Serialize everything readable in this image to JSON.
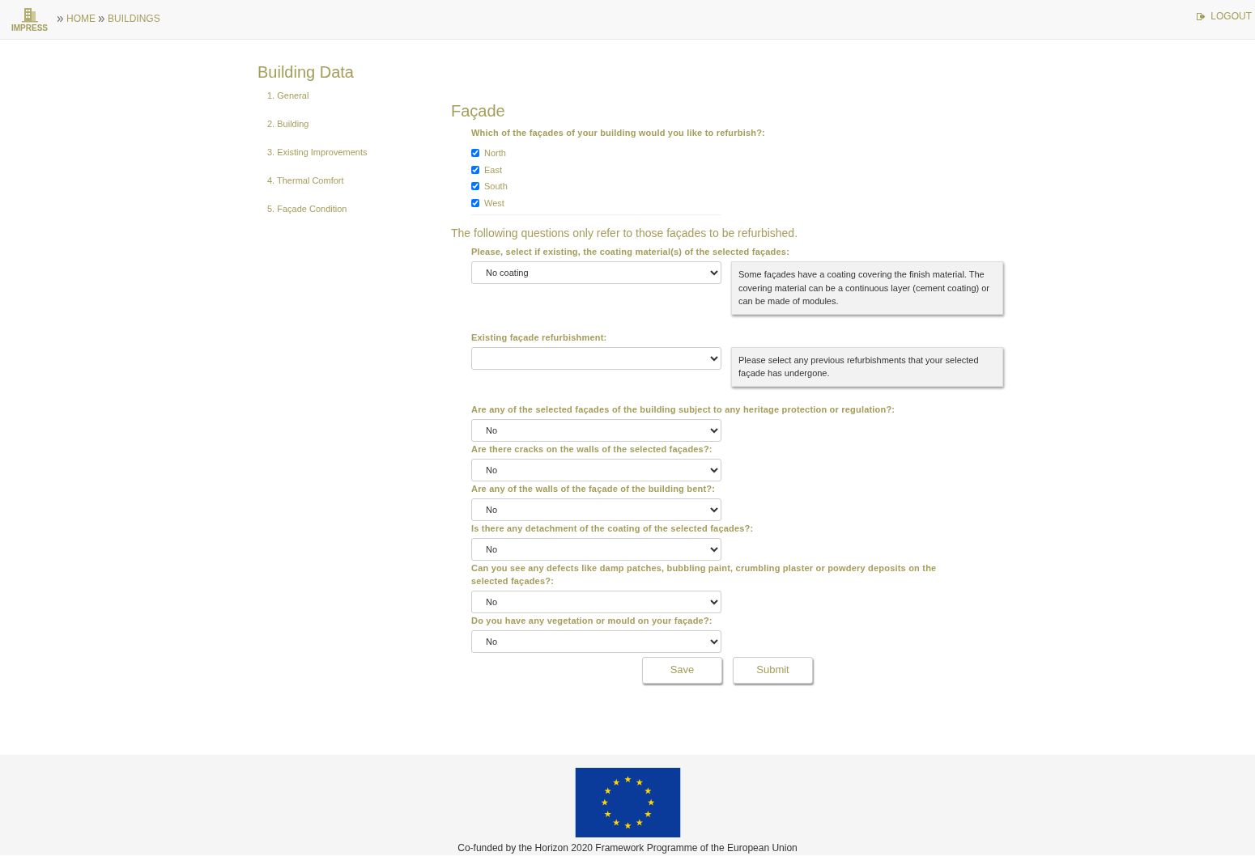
{
  "navbar": {
    "logo_text": "IMPRESS",
    "breadcrumb": [
      {
        "label": "HOME"
      },
      {
        "label": "BUILDINGS"
      }
    ],
    "logout": "LOGOUT"
  },
  "sidebar": {
    "title": "Building Data",
    "items": [
      {
        "label": "1. General"
      },
      {
        "label": "2. Building"
      },
      {
        "label": "3. Existing Improvements"
      },
      {
        "label": "4. Thermal Comfort"
      },
      {
        "label": "5. Façade Condition"
      }
    ]
  },
  "section": {
    "title": "Façade",
    "question": "Which of the façades of your building would you like to refurbish?:",
    "options": [
      {
        "label": "North",
        "checked": true
      },
      {
        "label": "East",
        "checked": true
      },
      {
        "label": "South",
        "checked": true
      },
      {
        "label": "West",
        "checked": true
      }
    ],
    "note": "The following questions only refer to those façades to be refurbished.",
    "fields": [
      {
        "label": "Please, select if existing, the coating material(s) of the selected façades:",
        "value": "No coating",
        "help": "Some façades have a coating covering the finish material. The covering material can be a continuous layer (cement coating) or can be made of modules."
      },
      {
        "label": "Existing façade refurbishment:",
        "help": "Please select any previous refurbishments that your selected façade has undergone."
      },
      {
        "label": "Are any of the selected façades of the building subject to any heritage protection or regulation?:",
        "value": "No"
      },
      {
        "label": "Are there cracks on the walls of the selected façades?:",
        "value": "No"
      },
      {
        "label": "Are any of the walls of the façade of the building bent?:",
        "value": "No"
      },
      {
        "label": "Is there any detachment of the coating of the selected façades?:",
        "value": "No"
      },
      {
        "label": "Can you see any defects like damp patches, bubbling paint, crumbling plaster or powdery deposits on the selected façades?:",
        "value": "No"
      },
      {
        "label": "Do you have any vegetation or mould on your façade?:",
        "value": "No"
      }
    ],
    "buttons": [
      "Save",
      "Submit"
    ]
  },
  "footer": {
    "text": "Co-funded by the Horizon 2020 Framework Programme of the European Union"
  }
}
